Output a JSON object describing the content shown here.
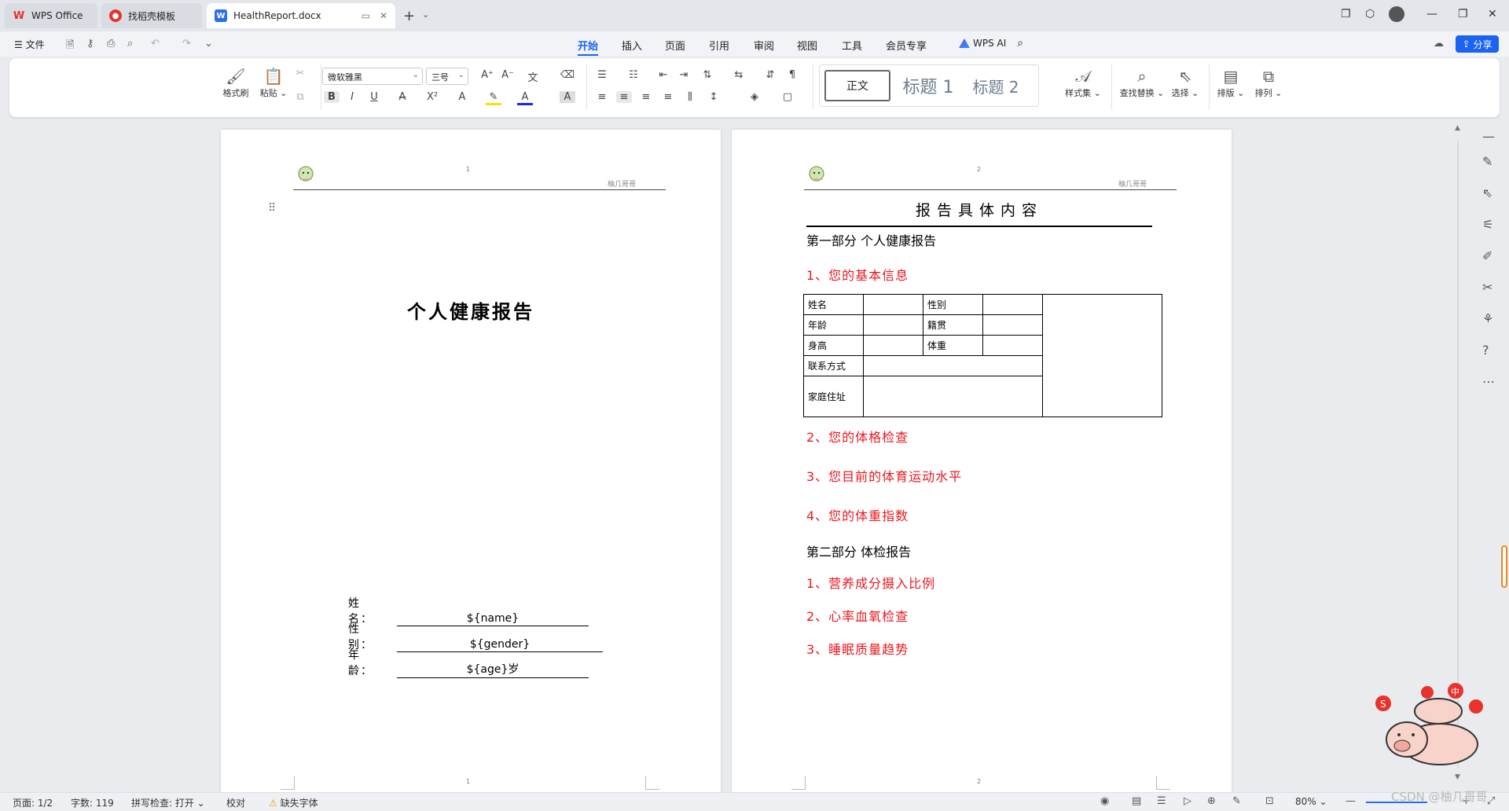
{
  "tabs": [
    {
      "label": "WPS Office",
      "icon": "wps-logo-icon"
    },
    {
      "label": "找稻壳模板",
      "icon": "docer-icon"
    },
    {
      "label": "HealthReport.docx",
      "icon": "word-doc-icon"
    }
  ],
  "menubar": {
    "file_label": "文件",
    "tabs": [
      "开始",
      "插入",
      "页面",
      "引用",
      "审阅",
      "视图",
      "工具",
      "会员专享"
    ],
    "active_tab": "开始",
    "ai_label": "WPS AI",
    "share_label": "分享"
  },
  "ribbon": {
    "format_painter": "格式刷",
    "paste": "粘贴",
    "font_name": "微软雅黑",
    "font_size": "三号",
    "styles": {
      "normal": "正文",
      "h1": "标题 1",
      "h2": "标题 2"
    },
    "style_set": "样式集",
    "find_replace": "查找替换",
    "select": "选择",
    "layout": "排版",
    "arrange": "排列"
  },
  "page1": {
    "header_num": "1",
    "header_right": "柚几哥哥",
    "title": "个人健康报告",
    "fields": [
      {
        "label": "姓　名：",
        "value": "${name}"
      },
      {
        "label": "性　别：",
        "value": "${gender}"
      },
      {
        "label": "年　龄：",
        "value": "${age}岁"
      }
    ],
    "footer_num": "1"
  },
  "page2": {
    "header_num": "2",
    "header_right": "柚几哥哥",
    "title": "报告具体内容",
    "part1": "第一部分  个人健康报告",
    "items1": [
      "1、您的基本信息",
      "2、您的体格检查",
      "3、您目前的体育运动水平",
      "4、您的体重指数"
    ],
    "table": {
      "name": "姓名",
      "gender": "性别",
      "age": "年龄",
      "native": "籍贯",
      "height": "身高",
      "weight": "体重",
      "contact": "联系方式",
      "address": "家庭住址"
    },
    "part2": "第二部分  体检报告",
    "items2": [
      "1、营养成分摄入比例",
      "2、心率血氧检查",
      "3、睡眠质量趋势"
    ],
    "footer_num": "2"
  },
  "statusbar": {
    "page": "页面: 1/2",
    "words": "字数: 119",
    "spell": "拼写检查: 打开",
    "proof": "校对",
    "missing_font": "缺失字体",
    "zoom": "80%"
  },
  "watermark": "CSDN @柚几哥哥",
  "colors": {
    "accent": "#1b63f0",
    "red_text": "#e8191f"
  }
}
